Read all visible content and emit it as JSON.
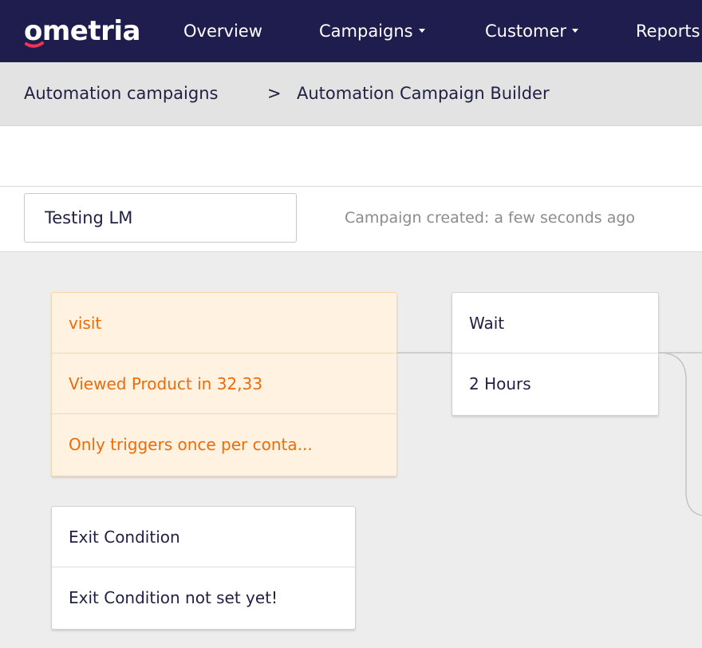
{
  "brand": {
    "logo_text": "ometria",
    "logo_accent_color": "#e8384f",
    "nav_bg_color": "#1e1d4d"
  },
  "nav": {
    "items": [
      {
        "label": "Overview",
        "has_dropdown": false
      },
      {
        "label": "Campaigns",
        "has_dropdown": true
      },
      {
        "label": "Customer",
        "has_dropdown": true
      },
      {
        "label": "Reports",
        "has_dropdown": false
      }
    ]
  },
  "breadcrumb": {
    "parent": "Automation campaigns",
    "separator": ">",
    "current": "Automation Campaign Builder"
  },
  "campaign": {
    "name_value": "Testing LM",
    "created_text": "Campaign created: a few seconds ago"
  },
  "canvas": {
    "trigger": {
      "title": "visit",
      "detail": "Viewed Product in 32,33",
      "frequency": "Only triggers once per conta...",
      "accent_color": "#ee6b0a"
    },
    "wait": {
      "title": "Wait",
      "duration": "2 Hours"
    },
    "exit_condition": {
      "title": "Exit Condition",
      "status": "Exit Condition not set yet!"
    }
  }
}
